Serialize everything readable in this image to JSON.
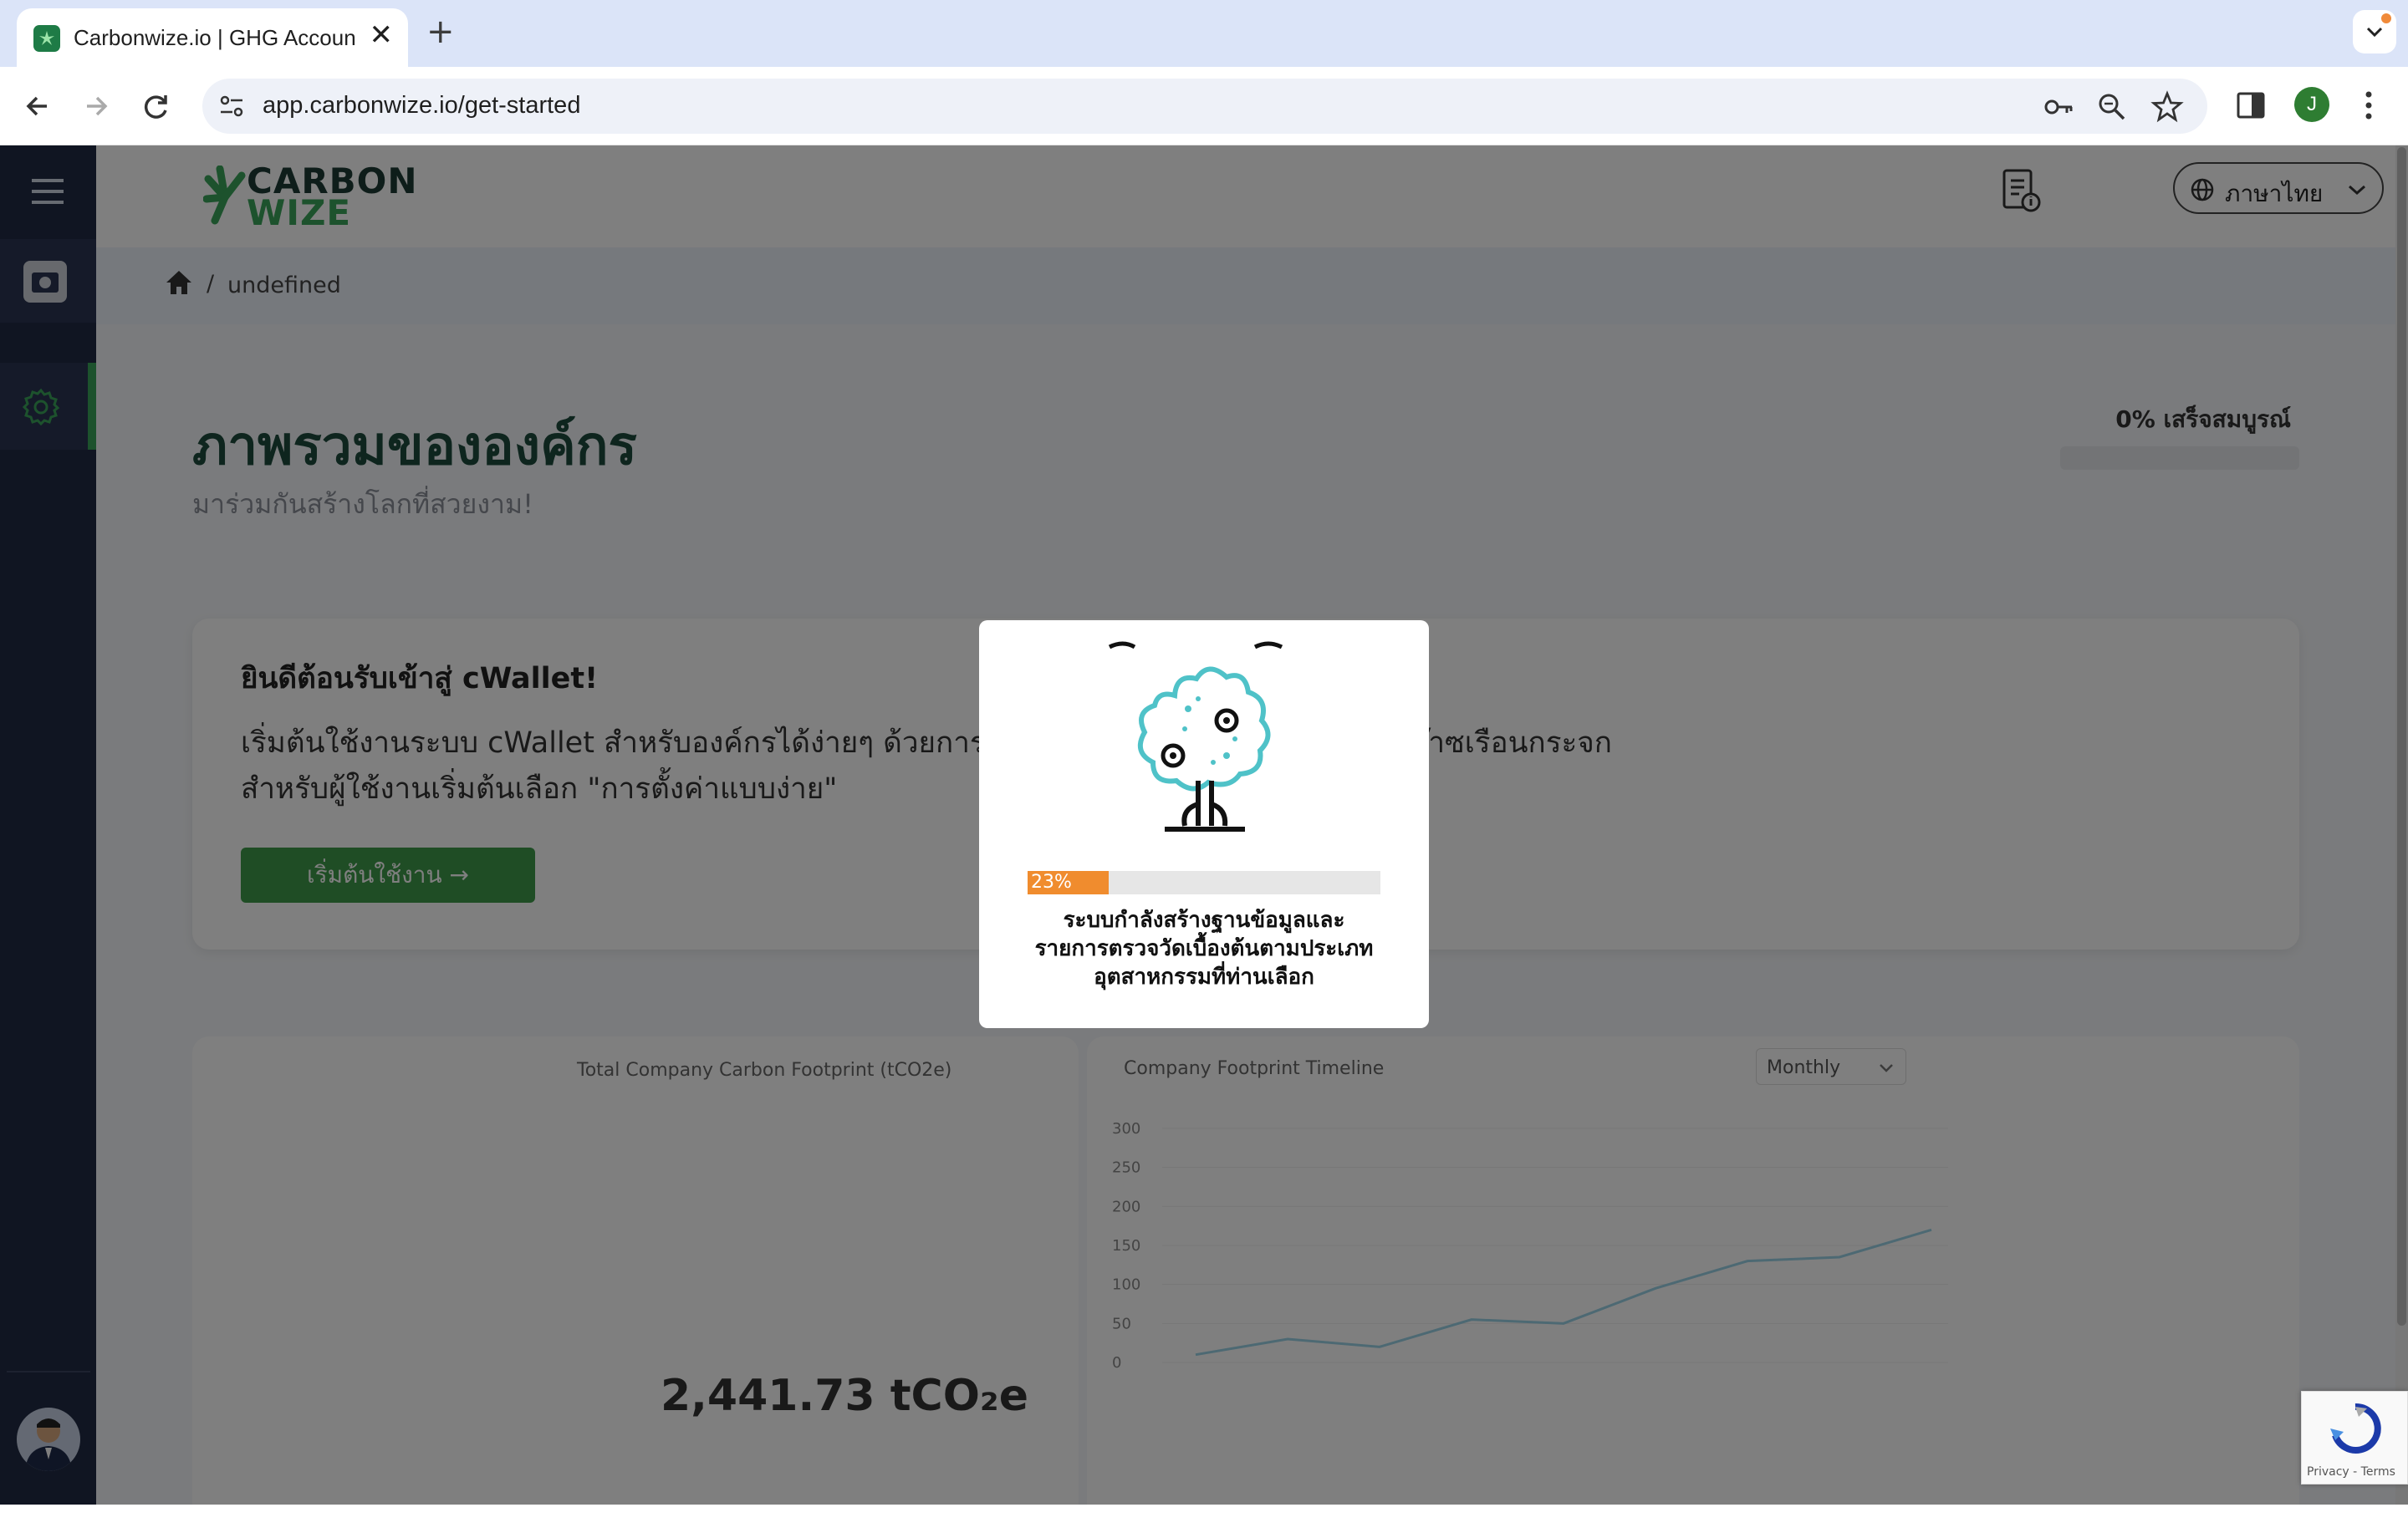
{
  "browser": {
    "tab_title": "Carbonwize.io | GHG Accoun",
    "url": "app.carbonwize.io/get-started",
    "profile_initial": "J",
    "new_tab": "+",
    "close": "✕"
  },
  "app": {
    "logo_line1": "CARBON",
    "logo_line2": "WIZE",
    "language": "ภาษาไทย",
    "breadcrumb": {
      "separator": "/",
      "current": "undefined"
    },
    "page_title": "ภาพรวมขององค์กร",
    "page_subtitle": "มาร่วมกันสร้างโลกที่สวยงาม!",
    "progress": {
      "label": "0% เสร็จสมบูรณ์",
      "value": 0
    },
    "welcome_card": {
      "title": "ยินดีต้อนรับเข้าสู่ cWallet!",
      "description_line1": "เริ่มต้นใช้งานระบบ cWallet สำหรับองค์กรได้ง่ายๆ ด้วยการตั้ง",
      "description_line1_end": "ก๊าซเรือนกระจก",
      "description_line2": "สำหรับผู้ใช้งานเริ่มต้นเลือก \"การตั้งค่าแบบง่าย\"",
      "button": "เริ่มต้นใช้งาน →"
    },
    "charts": {
      "left_title": "Total Company Carbon Footprint (tCO2e)",
      "right_title": "Company Footprint Timeline",
      "timeline_select": "Monthly",
      "total_value": "2,441.73 tCO₂e",
      "y_ticks": [
        "300",
        "250",
        "200",
        "150",
        "100",
        "50",
        "0"
      ],
      "timeline_values": [
        10,
        30,
        20,
        55,
        50,
        95,
        130,
        135,
        170
      ]
    }
  },
  "modal": {
    "percent_label": "23%",
    "percent_value": 23,
    "text_line1": "ระบบกำลังสร้างฐานข้อมูลและ",
    "text_line2": "รายการตรวจวัดเบื้องต้นตามประเภท",
    "text_line3": "อุตสาหกรรมที่ท่านเลือก"
  },
  "recaptcha": {
    "privacy": "Privacy",
    "separator": " - ",
    "terms": "Terms"
  },
  "colors": {
    "brand_green": "#3f9a4a",
    "sidebar_bg": "#202a44",
    "accent_orange": "#f08c2e",
    "title_green": "#1c4b3c"
  }
}
